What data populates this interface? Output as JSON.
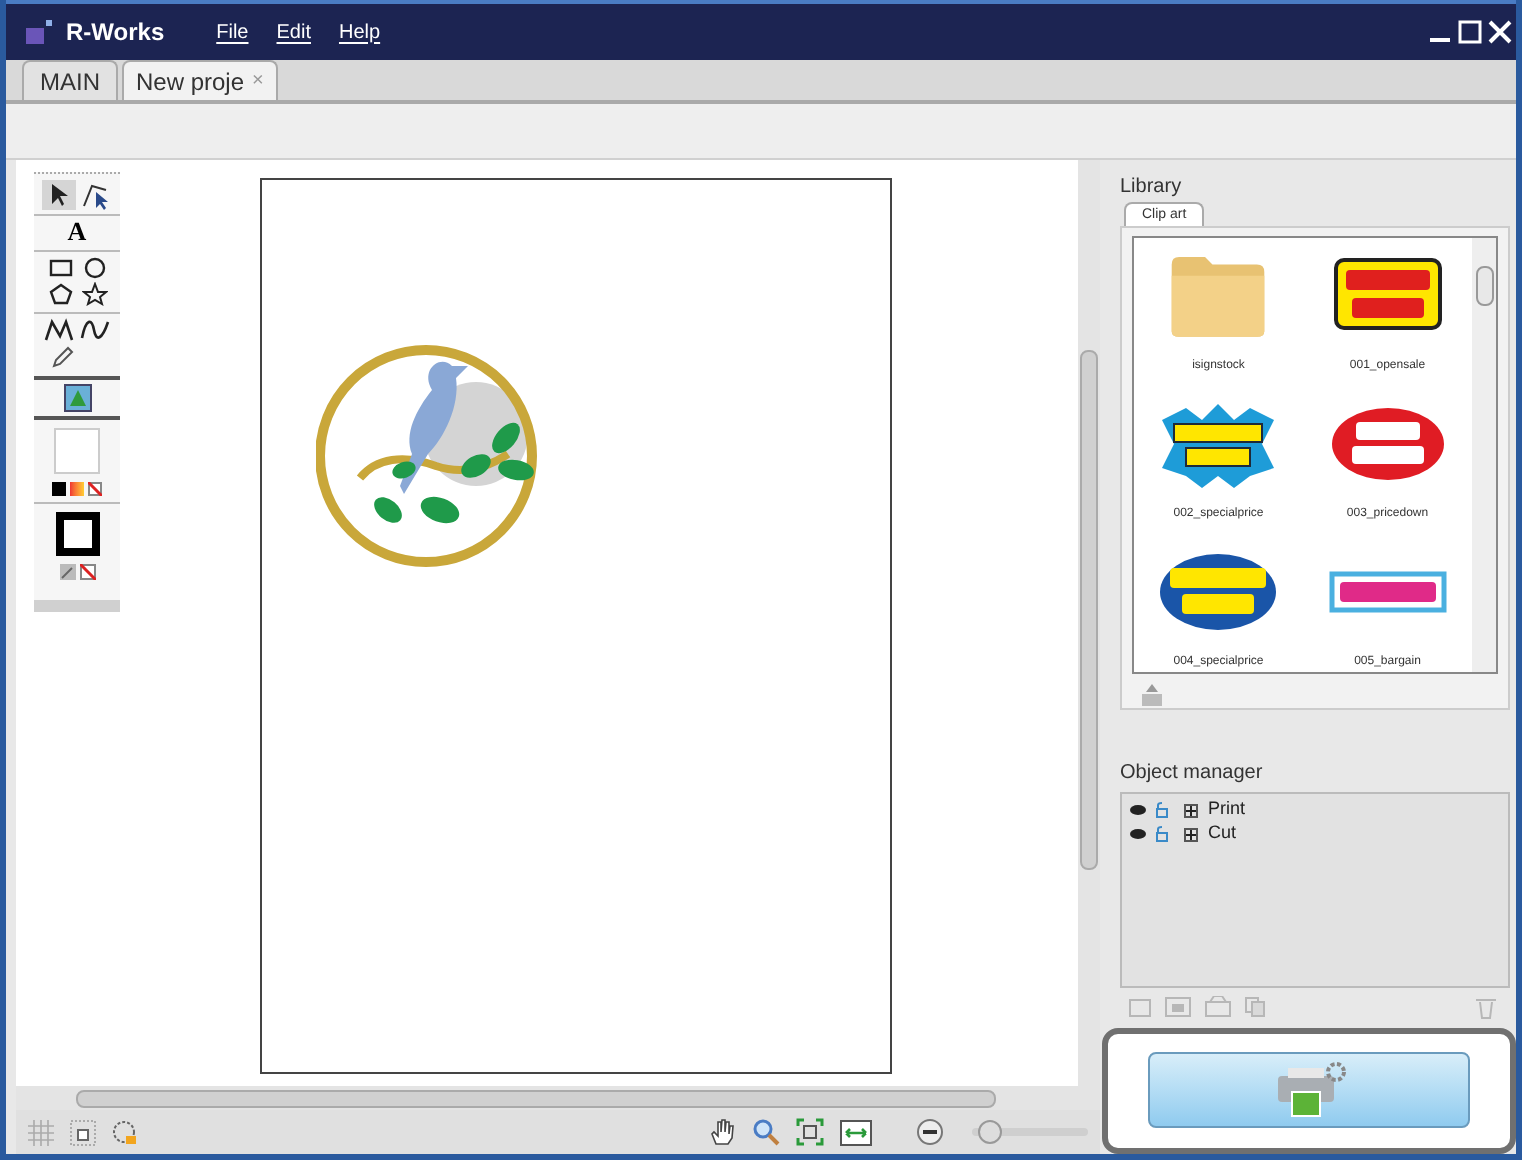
{
  "window": {
    "title": "R-Works"
  },
  "menu": [
    "File",
    "Edit",
    "Help"
  ],
  "tabs": [
    {
      "label": "MAIN",
      "selected": false,
      "closable": false
    },
    {
      "label": "New proje",
      "selected": true,
      "closable": true,
      "close_glyph": "×"
    }
  ],
  "toolbox": {
    "text_tool": "A"
  },
  "library": {
    "title": "Library",
    "tabs": [
      {
        "label": "Clip art",
        "selected": true
      }
    ],
    "items": [
      {
        "kind": "folder",
        "label": "isignstock"
      },
      {
        "kind": "picture",
        "label": "001_opensale"
      },
      {
        "kind": "picture",
        "label": "002_specialprice"
      },
      {
        "kind": "picture",
        "label": "003_pricedown"
      },
      {
        "kind": "picture",
        "label": "004_specialprice"
      },
      {
        "kind": "picture",
        "label": "005_bargain"
      }
    ]
  },
  "object_manager": {
    "title": "Object manager",
    "layers": [
      {
        "label": "Print",
        "expanded": false
      },
      {
        "label": "Cut",
        "expanded": false
      }
    ]
  },
  "zoom_slider": {
    "level": 0.05
  }
}
